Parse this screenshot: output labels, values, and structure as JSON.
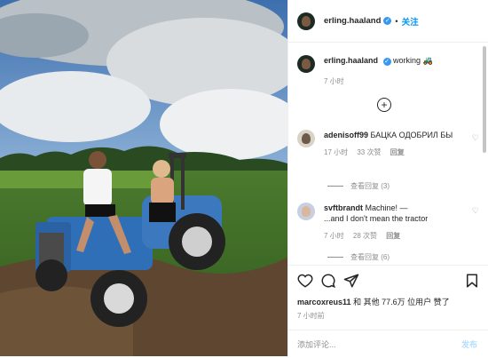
{
  "post": {
    "username": "erling.haaland",
    "follow_label": "关注",
    "caption_text": "working 🚜",
    "caption_time": "7 小时",
    "likes_user": "marcoxreus11",
    "likes_text": "和 其他 77.6万 位用户 赞了",
    "post_time": "7 小时前",
    "add_comment_placeholder": "添加评论...",
    "post_button": "发布"
  },
  "comments": [
    {
      "username": "adenisoff99",
      "text": "БАЦКА ОДОБРИЛ БЫ",
      "time": "17 小时",
      "likes": "33 次赞",
      "reply": "回复",
      "view_replies": "查看回复 (3)"
    },
    {
      "username": "svftbrandt",
      "text": "Machine! —\n...and I don't mean the tractor",
      "time": "7 小时",
      "likes": "28 次赞",
      "reply": "回复",
      "view_replies": "查看回复 (6)"
    }
  ],
  "icons": {
    "heart": "heart-icon",
    "comment": "comment-icon",
    "share": "share-icon",
    "save": "bookmark-icon",
    "add": "plus-circle-icon",
    "verified": "verified-badge-icon"
  },
  "colors": {
    "link_blue": "#0095f6",
    "verified_blue": "#3897f0",
    "muted": "#8e8e8e",
    "tractor_blue": "#2f6fb8"
  }
}
